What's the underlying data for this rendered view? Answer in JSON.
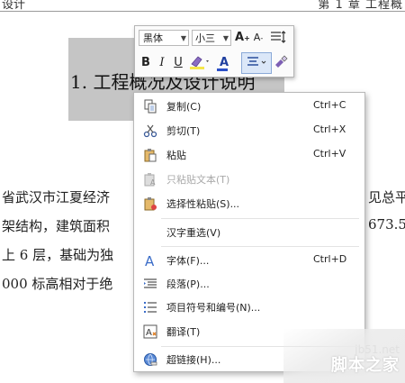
{
  "header": {
    "left": "设计",
    "right": "第 1 章 工程概"
  },
  "document": {
    "title": "1. 工程概况及设计说明",
    "lines": [
      {
        "left": "省武汉市江夏经济",
        "right": "见总平"
      },
      {
        "left": "架结构，建筑面积",
        "right": "673.5"
      },
      {
        "left": "上 6 层，基础为独",
        "right": ""
      },
      {
        "left": "000 标高相对于绝",
        "right": ""
      }
    ]
  },
  "mini_toolbar": {
    "font": "黑体",
    "size": "小三",
    "grow": "A",
    "shrink": "A",
    "bold": "B",
    "italic": "I",
    "underline": "U",
    "font_color": "A",
    "highlight_color": "#f5e64a",
    "font_color_value": "#2b4fc7"
  },
  "context_menu": {
    "items": [
      {
        "icon": "copy-icon",
        "label": "复制(C)",
        "shortcut": "Ctrl+C",
        "disabled": false
      },
      {
        "icon": "cut-icon",
        "label": "剪切(T)",
        "shortcut": "Ctrl+X",
        "disabled": false
      },
      {
        "icon": "paste-icon",
        "label": "粘贴",
        "shortcut": "Ctrl+V",
        "disabled": false
      },
      {
        "icon": "paste-text-icon",
        "label": "只粘贴文本(T)",
        "shortcut": "",
        "disabled": true
      },
      {
        "icon": "paste-special-icon",
        "label": "选择性粘贴(S)...",
        "shortcut": "",
        "disabled": false
      },
      {
        "icon": "",
        "label": "汉字重选(V)",
        "shortcut": "",
        "disabled": false
      },
      {
        "icon": "font-icon",
        "label": "字体(F)...",
        "shortcut": "Ctrl+D",
        "disabled": false
      },
      {
        "icon": "paragraph-icon",
        "label": "段落(P)...",
        "shortcut": "",
        "disabled": false
      },
      {
        "icon": "list-icon",
        "label": "项目符号和编号(N)...",
        "shortcut": "",
        "disabled": false
      },
      {
        "icon": "translate-icon",
        "label": "翻译(T)",
        "shortcut": "",
        "disabled": false
      },
      {
        "icon": "hyperlink-icon",
        "label": "超链接(H)...",
        "shortcut": "",
        "disabled": false
      }
    ]
  },
  "watermark": {
    "site": "jb51.net",
    "name": "脚本之家"
  }
}
